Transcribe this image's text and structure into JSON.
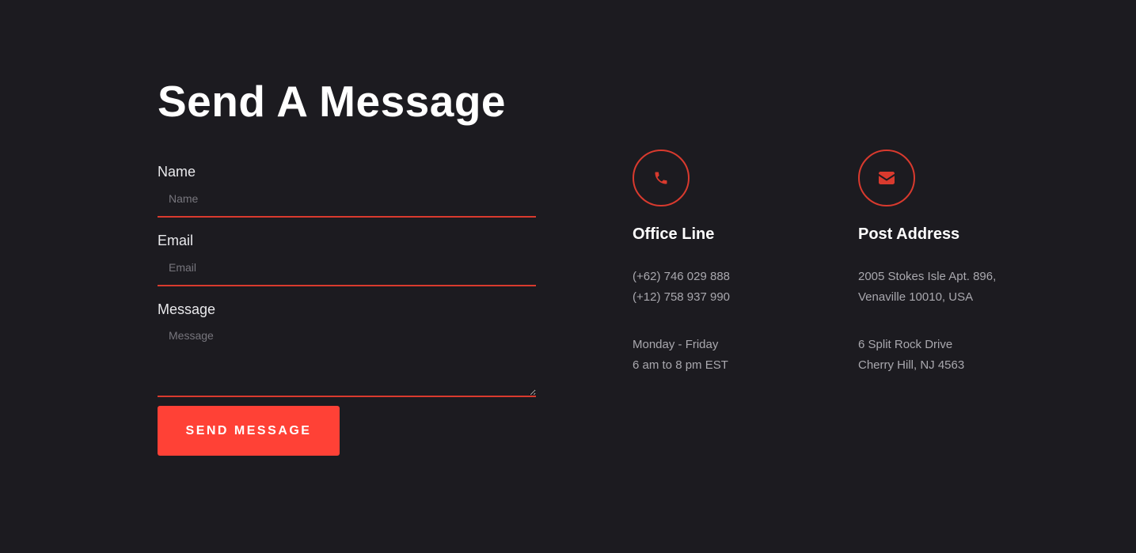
{
  "heading": "Send A Message",
  "form": {
    "name": {
      "label": "Name",
      "placeholder": "Name",
      "value": ""
    },
    "email": {
      "label": "Email",
      "placeholder": "Email",
      "value": ""
    },
    "message": {
      "label": "Message",
      "placeholder": "Message",
      "value": ""
    },
    "submit_label": "SEND MESSAGE"
  },
  "contacts": {
    "office": {
      "icon": "phone-icon",
      "title": "Office Line",
      "block1": [
        "(+62) 746 029 888",
        "(+12) 758 937 990"
      ],
      "block2": [
        "Monday - Friday",
        "6 am to 8 pm EST"
      ]
    },
    "post": {
      "icon": "envelope-icon",
      "title": "Post Address",
      "block1": [
        "2005 Stokes Isle Apt. 896,",
        "Venaville 10010, USA"
      ],
      "block2": [
        "6 Split Rock Drive",
        "Cherry Hill, NJ 4563"
      ]
    }
  },
  "colors": {
    "background": "#1c1b20",
    "accent": "#ff4136",
    "accent_line": "#d93a2e",
    "heading": "#ffffff",
    "body_text": "#a9a8ae"
  }
}
